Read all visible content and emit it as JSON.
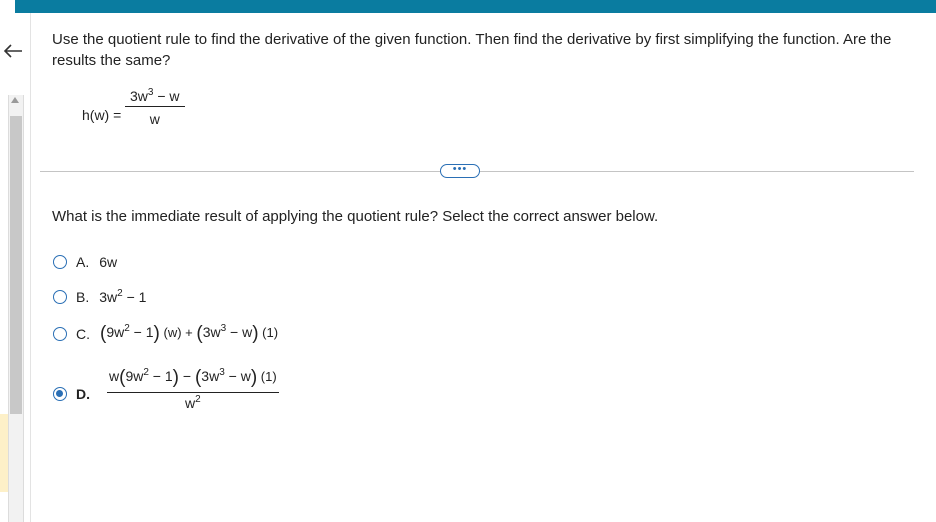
{
  "question": {
    "text": "Use the quotient rule to find the derivative of the given function. Then find the derivative by first simplifying the function. Are the results the same?"
  },
  "function": {
    "label": "h(w) =",
    "numerator_base": "3w",
    "numerator_exp": "3",
    "numerator_rest": " − w",
    "denominator": "w"
  },
  "more_button": {
    "label": "•••"
  },
  "prompt": "What is the immediate result of applying the quotient rule? Select the correct answer below.",
  "options": [
    {
      "letter": "A.",
      "text": "6w",
      "selected": false
    },
    {
      "letter": "B.",
      "base": "3w",
      "exp": "2",
      "rest": " − 1",
      "selected": false
    },
    {
      "letter": "C.",
      "p1_open": "(",
      "p1_base": "9w",
      "p1_exp": "2",
      "p1_rest": " − 1",
      "p1_close": ")",
      "m1": " (w) + ",
      "p2_open": "(",
      "p2_base": "3w",
      "p2_exp": "3",
      "p2_rest": " − w",
      "p2_close": ")",
      "m2": " (1)",
      "selected": false
    },
    {
      "letter": "D.",
      "num_lead": "w",
      "p1_open": "(",
      "p1_base": "9w",
      "p1_exp": "2",
      "p1_rest": " − 1",
      "p1_close": ")",
      "mid": " − ",
      "p2_open": "(",
      "p2_base": "3w",
      "p2_exp": "3",
      "p2_rest": " − w",
      "p2_close": ")",
      "m2": " (1)",
      "den_base": "w",
      "den_exp": "2",
      "selected": true
    }
  ],
  "colors": {
    "topbar": "#0a7ca0",
    "accent": "#2a6fb5"
  }
}
